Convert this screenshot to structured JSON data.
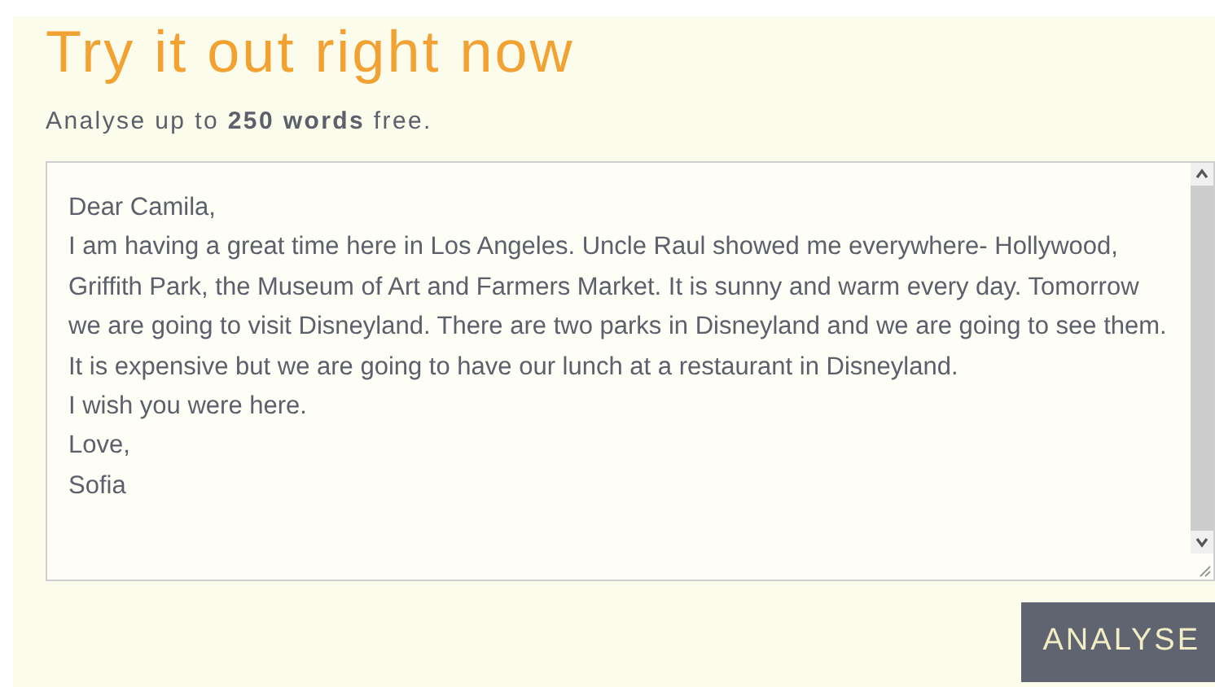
{
  "heading": "Try it out right now",
  "subtitle": "Analyse up to **250 words** free.",
  "text_field": {
    "value": "Dear Camila,\nI am having a great time here in Los Angeles. Uncle Raul showed me everywhere- Hollywood, Griffith Park, the Museum of Art and Farmers Market. It is sunny and warm every day. Tomorrow we are going to visit Disneyland. There are two parks in Disneyland and we are going to see them. It is expensive but we are going to have our lunch at a restaurant in Disneyland.\nI wish you were here.\nLove,\nSofia"
  },
  "buttons": [
    "ANALYSE"
  ]
}
